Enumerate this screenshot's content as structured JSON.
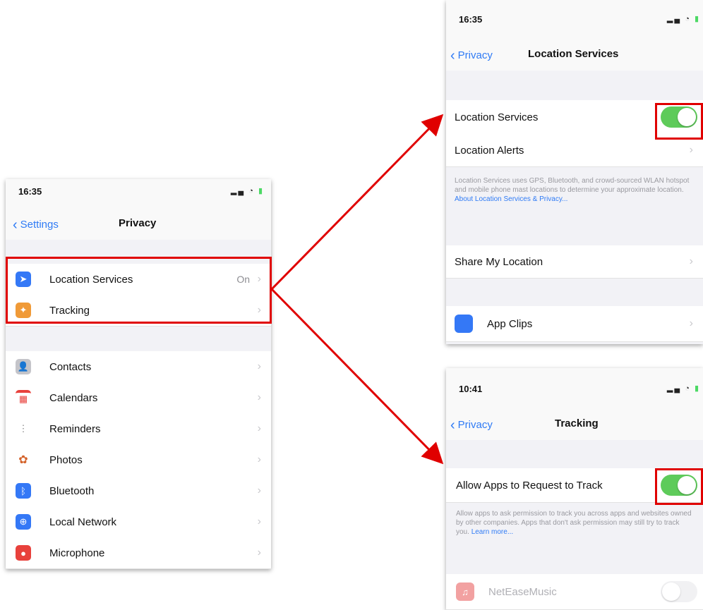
{
  "colors": {
    "accent": "#2f7bf5",
    "toggle_on": "#5ecb5a",
    "highlight": "#e00000"
  },
  "privacy": {
    "time": "16:35",
    "back_label": "Settings",
    "title": "Privacy",
    "group1": [
      {
        "label": "Location Services",
        "value": "On",
        "icon": "location-arrow-icon",
        "color": "#3478f6"
      },
      {
        "label": "Tracking",
        "value": "",
        "icon": "tracking-icon",
        "color": "#f09a37"
      }
    ],
    "group2": [
      {
        "label": "Contacts",
        "icon": "contacts-icon",
        "color": "#b9b9be"
      },
      {
        "label": "Calendars",
        "icon": "calendar-icon",
        "color": "#ffffff"
      },
      {
        "label": "Reminders",
        "icon": "reminders-icon",
        "color": "#ffffff"
      },
      {
        "label": "Photos",
        "icon": "photos-icon",
        "color": "#ffffff"
      },
      {
        "label": "Bluetooth",
        "icon": "bluetooth-icon",
        "color": "#3478f6"
      },
      {
        "label": "Local Network",
        "icon": "network-icon",
        "color": "#3478f6"
      },
      {
        "label": "Microphone",
        "icon": "microphone-icon",
        "color": "#e8413c"
      }
    ]
  },
  "location": {
    "time": "16:35",
    "back_label": "Privacy",
    "title": "Location Services",
    "toggle_label": "Location Services",
    "toggle_on": true,
    "alerts_label": "Location Alerts",
    "footer_text": "Location Services uses GPS, Bluetooth, and crowd-sourced WLAN hotspot and mobile phone mast locations to determine your approximate location.",
    "footer_link": "About Location Services & Privacy...",
    "share_label": "Share My Location",
    "appclips_label": "App Clips"
  },
  "tracking": {
    "time": "10:41",
    "back_label": "Privacy",
    "title": "Tracking",
    "toggle_label": "Allow Apps to Request to Track",
    "toggle_on": true,
    "footer_text": "Allow apps to ask permission to track you across apps and websites owned by other companies. Apps that don't ask permission may still try to track you.",
    "footer_link": "Learn more...",
    "app_label": "NetEaseMusic",
    "app_toggle_on": false
  }
}
